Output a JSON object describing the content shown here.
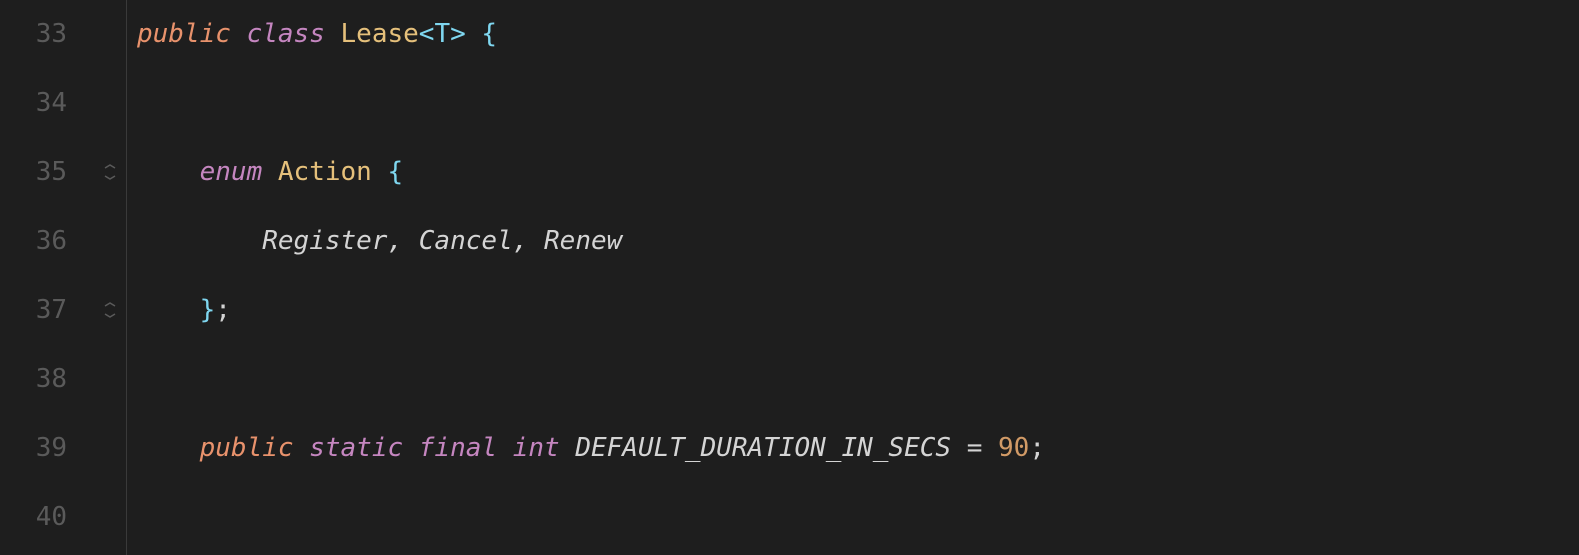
{
  "lines": {
    "33": "33",
    "34": "34",
    "35": "35",
    "36": "36",
    "37": "37",
    "38": "38",
    "39": "39",
    "40": "40"
  },
  "code": {
    "l33": {
      "public": "public",
      "class": "class",
      "name": "Lease",
      "generic": "<T>",
      "brace": "{"
    },
    "l35": {
      "enum": "enum",
      "name": "Action",
      "brace": "{"
    },
    "l36": {
      "v1": "Register",
      "c1": ",",
      "v2": "Cancel",
      "c2": ",",
      "v3": "Renew"
    },
    "l37": {
      "brace": "}",
      "semi": ";"
    },
    "l39": {
      "public": "public",
      "static": "static",
      "final": "final",
      "int": "int",
      "name": "DEFAULT_DURATION_IN_SECS",
      "eq": "=",
      "val": "90",
      "semi": ";"
    }
  }
}
